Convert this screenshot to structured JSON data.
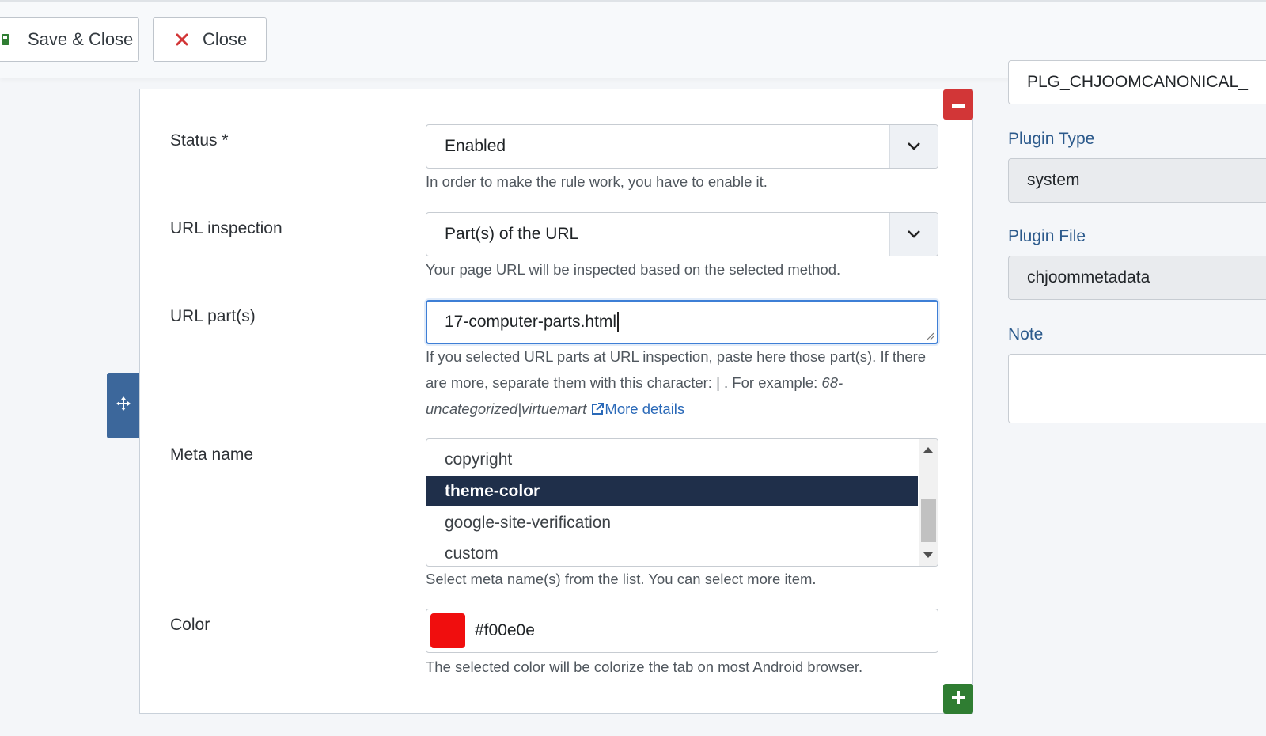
{
  "toolbar": {
    "save_close_label": "Save & Close",
    "close_label": "Close"
  },
  "form": {
    "status": {
      "label": "Status *",
      "value": "Enabled",
      "help": "In order to make the rule work, you have to enable it."
    },
    "url_inspection": {
      "label": "URL inspection",
      "value": "Part(s) of the URL",
      "help": "Your page URL will be inspected based on the selected method."
    },
    "url_parts": {
      "label": "URL part(s)",
      "value": "17-computer-parts.html",
      "help_part1": "If you selected URL parts at URL inspection, paste here those part(s). If there are more, separate them with this character: | . For example:",
      "help_example": "68-uncategorized|virtuemart",
      "help_link": "More details"
    },
    "meta_name": {
      "label": "Meta name",
      "options": [
        "copyright",
        "theme-color",
        "google-site-verification",
        "custom"
      ],
      "selected": "theme-color",
      "help": "Select meta name(s) from the list. You can select more item."
    },
    "color": {
      "label": "Color",
      "value": "#f00e0e",
      "swatch": "#f00e0e",
      "help": "The selected color will be colorize the tab on most Android browser."
    }
  },
  "sidebar": {
    "element_value": "PLG_CHJOOMCANONICAL_",
    "plugin_type_label": "Plugin Type",
    "plugin_type_value": "system",
    "plugin_file_label": "Plugin File",
    "plugin_file_value": "chjoommetadata",
    "note_label": "Note",
    "note_value": ""
  },
  "colors": {
    "remove_button": "#d23637",
    "add_button": "#2f7d32",
    "selected_option": "#1f2f4a",
    "move_handle": "#3c679b",
    "link": "#2a69b8"
  },
  "icons": {
    "save": "save-icon",
    "close": "close-x-icon",
    "remove": "minus-icon",
    "add": "plus-icon",
    "move": "move-arrows-icon",
    "dropdown": "chevron-down-icon",
    "external_link": "external-link-icon"
  }
}
